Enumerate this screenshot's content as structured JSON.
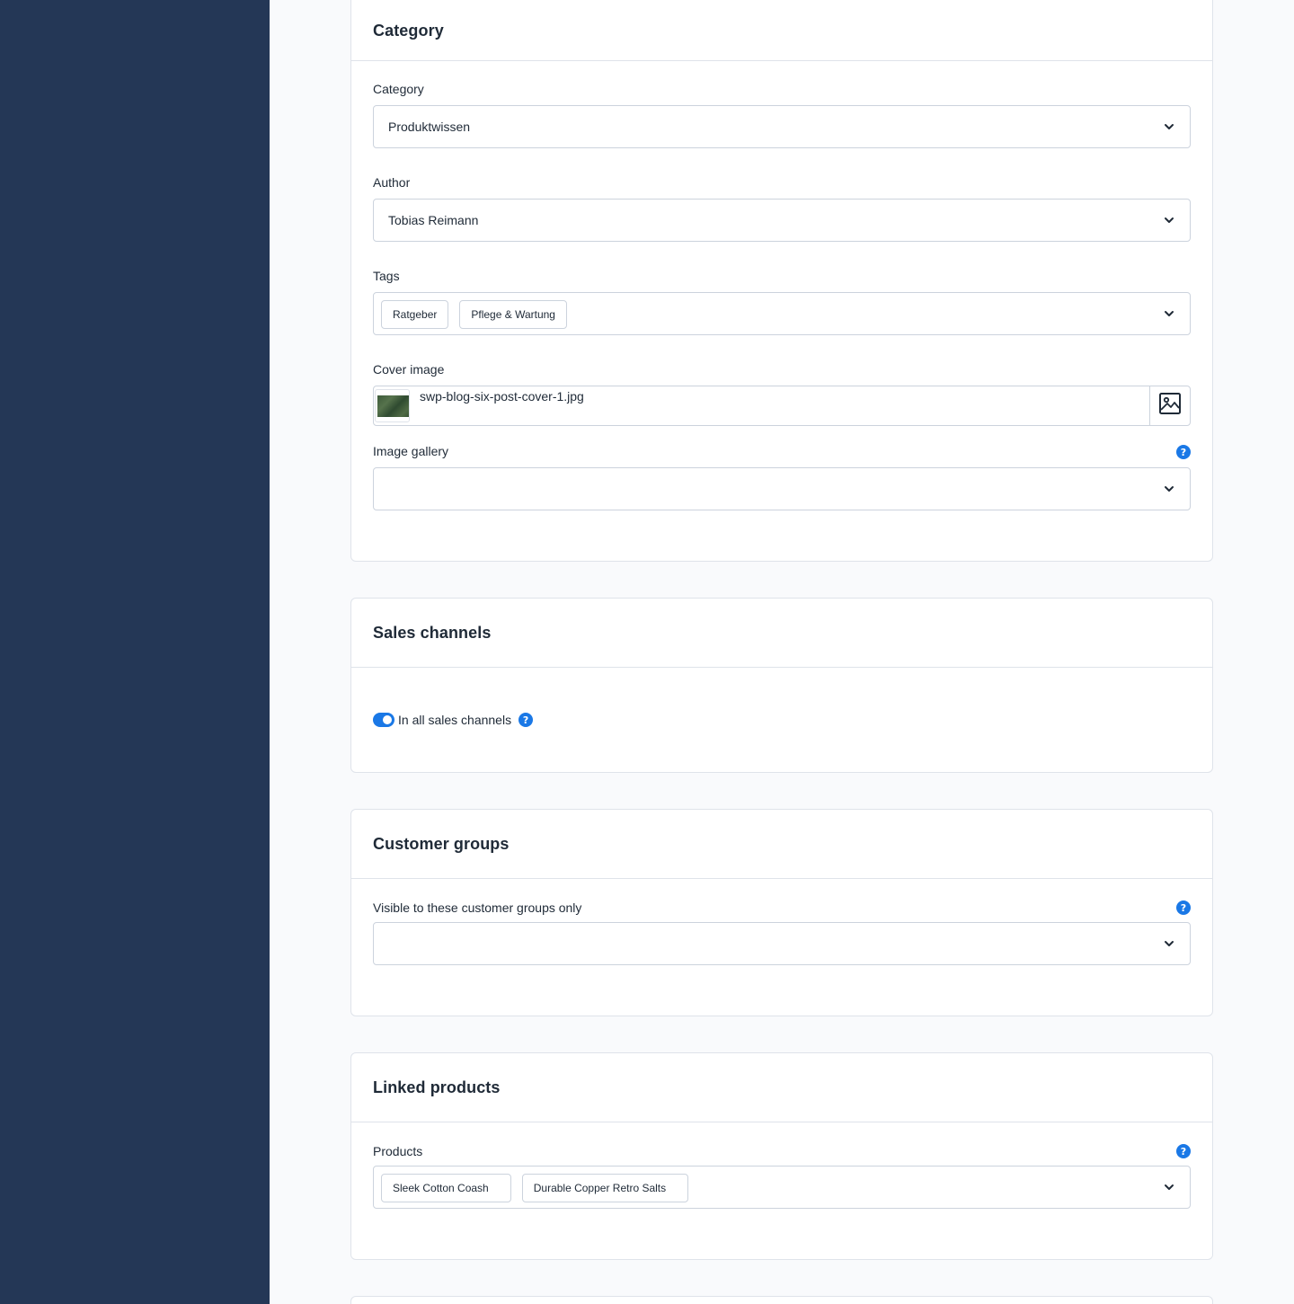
{
  "category_card": {
    "title": "Category",
    "category_label": "Category",
    "category_value": "Produktwissen",
    "author_label": "Author",
    "author_value": "Tobias Reimann",
    "tags_label": "Tags",
    "tags": [
      "Ratgeber",
      "Pflege & Wartung"
    ],
    "cover_label": "Cover image",
    "cover_file": "swp-blog-six-post-cover-1.jpg",
    "gallery_label": "Image gallery"
  },
  "sales_channels_card": {
    "title": "Sales channels",
    "toggle_label": "In all sales channels",
    "toggle_on": true
  },
  "customer_groups_card": {
    "title": "Customer groups",
    "visibility_label": "Visible to these customer groups only"
  },
  "linked_products_card": {
    "title": "Linked products",
    "products_label": "Products",
    "products": [
      "Sleek Cotton Coash",
      "Durable Copper Retro Salts"
    ]
  },
  "icons": {
    "help": "?",
    "chevron": "chevron-down-icon",
    "image": "image-icon"
  },
  "colors": {
    "sidebar": "#243756",
    "accent": "#1a78e6",
    "border": "#ccd3dd"
  }
}
